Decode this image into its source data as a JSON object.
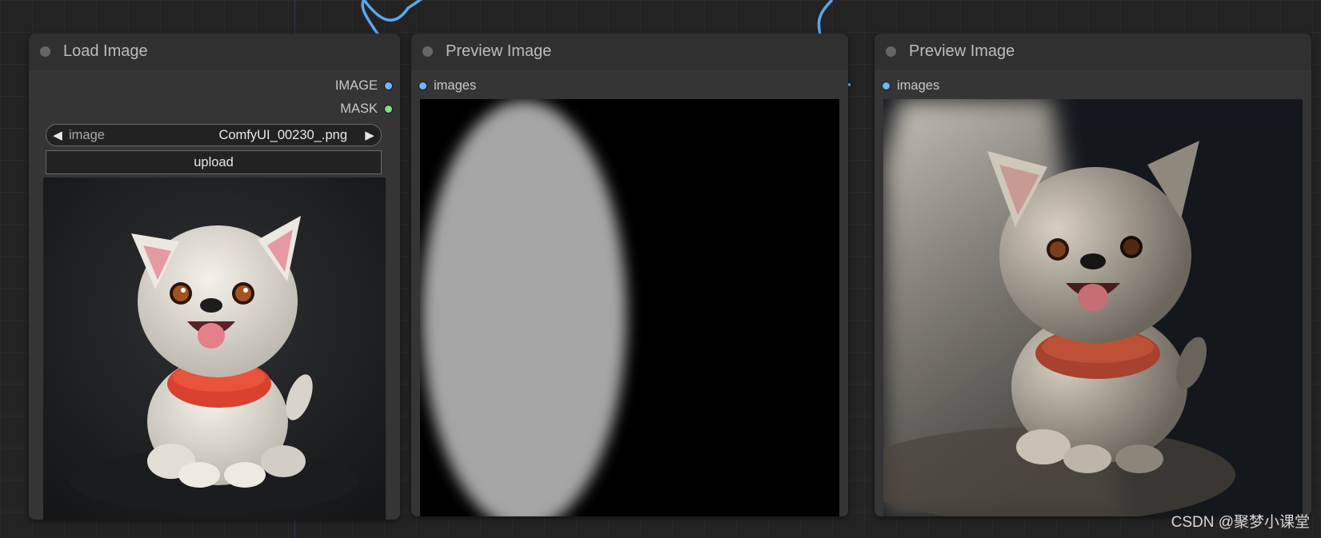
{
  "nodes": {
    "load_image": {
      "title": "Load Image",
      "outputs": [
        "IMAGE",
        "MASK"
      ],
      "image_widget": {
        "label": "image",
        "value": "ComfyUI_00230_.png"
      },
      "upload_label": "upload",
      "preview_alt": "white clay puppy figurine with red scarf on dark background"
    },
    "preview_mask": {
      "title": "Preview Image",
      "input": "images",
      "preview_alt": "gray blurred ellipse mask on black background"
    },
    "preview_result": {
      "title": "Preview Image",
      "input": "images",
      "preview_alt": "white puppy figurine lit by a spotlight beam from upper left"
    }
  },
  "icons": {
    "prev": "left-triangle-icon",
    "next": "right-triangle-icon"
  },
  "colors": {
    "image_port": "#6fb6ff",
    "mask_port": "#7ee07e",
    "link": "#5aa8f0"
  },
  "watermark": "CSDN @聚梦小课堂"
}
